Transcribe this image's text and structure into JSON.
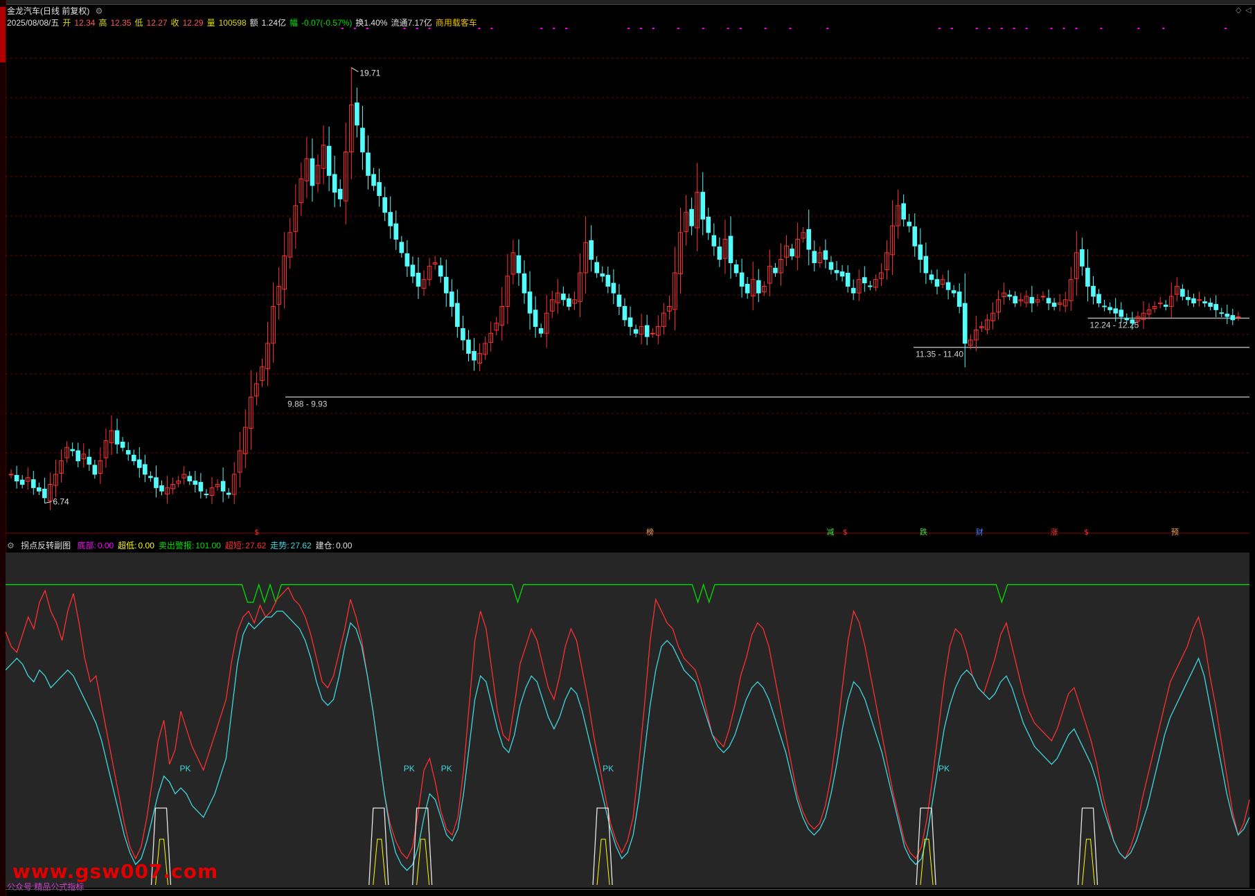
{
  "header": {
    "title": "金龙汽车(日线 前复权)",
    "date": "2025/08/08/五",
    "open_label": "开",
    "open": "12.34",
    "high_label": "高",
    "high": "12.35",
    "low_label": "低",
    "low": "12.27",
    "close_label": "收",
    "close": "12.29",
    "vol_label": "量",
    "vol": "100598",
    "amount_label": "额",
    "amount": "1.24亿",
    "change_label": "幅",
    "change": "-0.07(-0.57%)",
    "turnover": "换1.40%",
    "float": "流通7.17亿",
    "concept": "商用载客车"
  },
  "sub_header": {
    "name": "拐点反转副图",
    "items": [
      {
        "label": "底部:",
        "value": "0.00",
        "color": "#ff00ff"
      },
      {
        "label": "超低:",
        "value": "0.00",
        "color": "#ffff00"
      },
      {
        "label": "卖出警报:",
        "value": "101.00",
        "color": "#00e000"
      },
      {
        "label": "超短:",
        "value": "27.62",
        "color": "#ff3030"
      },
      {
        "label": "走势:",
        "value": "27.62",
        "color": "#40d8e0"
      },
      {
        "label": "建仓:",
        "value": "0.00",
        "color": "#e0e0e0"
      }
    ]
  },
  "watermark": "www.gsw007.com",
  "watermark_small": "公众号:精品公式指标",
  "colors": {
    "up": "#ff3232",
    "down": "#54fcfc",
    "grid": "#7a0000",
    "support": "#b0b0b0"
  },
  "chart_data": [
    {
      "type": "candlestick",
      "title": "金龙汽车(日线 前复权)",
      "ylim": [
        6.3,
        20.9
      ],
      "annotations": [
        {
          "text": "19.71",
          "value": 19.71,
          "kind": "high"
        },
        {
          "text": "6.74",
          "value": 6.74,
          "kind": "low"
        }
      ],
      "support_levels": [
        {
          "label": "9.88 - 9.93",
          "value": 9.9
        },
        {
          "label": "11.35 - 11.40",
          "value": 11.38
        },
        {
          "label": "12.24 - 12.25",
          "value": 12.25
        }
      ],
      "event_markers": [
        "$",
        "榜",
        "减",
        "$",
        "跌",
        "财",
        "涨",
        "$",
        "预"
      ],
      "closes": [
        7.6,
        7.4,
        7.3,
        7.5,
        7.2,
        7.1,
        6.9,
        7.3,
        7.6,
        8.0,
        8.4,
        8.3,
        8.0,
        8.2,
        7.9,
        7.6,
        8.0,
        8.6,
        8.9,
        8.5,
        8.4,
        8.2,
        8.0,
        7.8,
        7.6,
        7.5,
        7.2,
        7.1,
        7.2,
        7.3,
        7.4,
        7.6,
        7.4,
        7.3,
        7.1,
        7.0,
        7.2,
        7.3,
        7.1,
        7.0,
        7.6,
        8.3,
        9.0,
        9.9,
        10.3,
        10.8,
        11.5,
        12.6,
        13.2,
        14.1,
        14.8,
        15.6,
        16.4,
        17.0,
        16.2,
        16.8,
        17.4,
        16.5,
        16.0,
        15.8,
        17.2,
        18.6,
        18.0,
        17.2,
        16.5,
        16.2,
        15.9,
        15.4,
        15.0,
        14.6,
        14.2,
        13.8,
        13.5,
        13.2,
        13.4,
        13.8,
        13.9,
        13.5,
        13.0,
        12.6,
        12.0,
        11.6,
        11.2,
        11.0,
        11.2,
        11.5,
        11.8,
        12.1,
        12.6,
        13.5,
        14.2,
        13.6,
        13.0,
        12.4,
        12.0,
        11.8,
        12.4,
        12.8,
        13.0,
        12.8,
        12.6,
        12.8,
        13.6,
        14.5,
        14.0,
        13.6,
        13.5,
        13.2,
        13.0,
        12.6,
        12.2,
        12.0,
        11.8,
        12.0,
        11.7,
        11.8,
        12.0,
        12.4,
        12.6,
        13.6,
        14.8,
        15.4,
        15.0,
        16.0,
        15.2,
        14.8,
        14.4,
        14.0,
        14.6,
        13.9,
        13.6,
        13.2,
        13.0,
        13.4,
        13.0,
        13.2,
        13.8,
        13.6,
        14.0,
        14.4,
        14.1,
        14.6,
        14.8,
        14.3,
        13.9,
        14.2,
        14.0,
        13.7,
        13.6,
        13.5,
        13.2,
        13.0,
        13.4,
        13.3,
        13.2,
        13.4,
        13.6,
        14.2,
        15.0,
        15.6,
        15.2,
        15.0,
        14.4,
        14.0,
        13.6,
        13.4,
        13.2,
        13.4,
        13.1,
        13.0,
        12.6,
        11.5,
        11.6,
        11.9,
        12.0,
        12.2,
        12.4,
        12.8,
        13.0,
        12.9,
        12.7,
        12.8,
        12.9,
        12.7,
        12.8,
        12.9,
        12.7,
        12.6,
        12.7,
        12.8,
        13.4,
        14.2,
        13.8,
        13.2,
        12.9,
        12.7,
        12.6,
        12.5,
        12.4,
        12.3,
        12.2,
        12.1,
        12.3,
        12.4,
        12.5,
        12.6,
        12.7,
        12.6,
        12.9,
        13.2,
        12.9,
        12.8,
        12.7,
        12.8,
        12.7,
        12.6,
        12.5,
        12.4,
        12.3,
        12.2,
        12.29
      ]
    },
    {
      "type": "line",
      "title": "拐点反转副图",
      "ylim": [
        0,
        110
      ],
      "series": [
        {
          "name": "卖出警报",
          "color": "#00e000",
          "values": [
            101,
            101,
            101,
            101,
            101,
            101,
            101,
            101,
            101,
            101,
            101,
            101,
            101,
            101,
            101,
            101,
            101,
            101,
            101,
            101,
            101,
            101,
            101,
            101,
            101,
            101,
            101,
            101,
            101,
            101,
            101,
            101,
            101,
            101,
            101,
            101,
            101,
            101,
            101,
            101,
            101,
            101,
            101,
            95,
            95,
            101,
            95,
            101,
            95,
            101,
            101,
            101,
            101,
            101,
            101,
            101,
            101,
            101,
            101,
            101,
            101,
            101,
            101,
            101,
            101,
            101,
            101,
            101,
            101,
            101,
            101,
            101,
            101,
            101,
            101,
            101,
            101,
            101,
            101,
            101,
            101,
            101,
            101,
            101,
            101,
            101,
            101,
            101,
            101,
            101,
            101,
            95,
            101,
            101,
            101,
            101,
            101,
            101,
            101,
            101,
            101,
            101,
            101,
            101,
            101,
            101,
            101,
            101,
            101,
            101,
            101,
            101,
            101,
            101,
            101,
            101,
            101,
            101,
            101,
            101,
            101,
            101,
            101,
            95,
            101,
            95,
            101,
            101,
            101,
            101,
            101,
            101,
            101,
            101,
            101,
            101,
            101,
            101,
            101,
            101,
            101,
            101,
            101,
            101,
            101,
            101,
            101,
            101,
            101,
            101,
            101,
            101,
            101,
            101,
            101,
            101,
            101,
            101,
            101,
            101,
            101,
            101,
            101,
            101,
            101,
            101,
            101,
            101,
            101,
            101,
            101,
            101,
            101,
            101,
            101,
            101,
            101,
            95,
            101,
            101,
            101,
            101,
            101,
            101,
            101,
            101,
            101,
            101,
            101,
            101,
            101,
            101,
            101,
            101,
            101,
            101,
            101,
            101,
            101,
            101,
            101,
            101,
            101,
            101,
            101,
            101,
            101,
            101,
            101,
            101,
            101,
            101,
            101,
            101,
            101,
            101,
            101,
            101,
            101,
            101,
            101,
            101
          ]
        },
        {
          "name": "超短",
          "color": "#ff3030",
          "values": [
            85,
            80,
            78,
            84,
            90,
            86,
            95,
            99,
            92,
            88,
            82,
            92,
            98,
            88,
            76,
            68,
            70,
            60,
            50,
            40,
            30,
            20,
            12,
            8,
            12,
            22,
            35,
            48,
            55,
            40,
            45,
            58,
            52,
            46,
            42,
            38,
            44,
            50,
            56,
            62,
            75,
            85,
            90,
            92,
            88,
            94,
            90,
            92,
            96,
            98,
            100,
            96,
            94,
            90,
            84,
            76,
            68,
            66,
            70,
            78,
            86,
            96,
            90,
            82,
            70,
            58,
            44,
            30,
            20,
            14,
            10,
            8,
            12,
            24,
            38,
            42,
            34,
            24,
            18,
            16,
            22,
            38,
            60,
            82,
            92,
            86,
            72,
            58,
            50,
            48,
            60,
            74,
            80,
            86,
            82,
            74,
            66,
            62,
            70,
            80,
            86,
            82,
            72,
            62,
            50,
            40,
            30,
            20,
            14,
            10,
            14,
            22,
            40,
            60,
            82,
            96,
            92,
            88,
            86,
            80,
            76,
            74,
            72,
            66,
            58,
            50,
            48,
            46,
            52,
            60,
            70,
            76,
            84,
            88,
            86,
            80,
            70,
            60,
            50,
            40,
            30,
            24,
            20,
            18,
            20,
            26,
            36,
            50,
            66,
            82,
            92,
            88,
            80,
            70,
            60,
            50,
            40,
            30,
            22,
            14,
            10,
            8,
            12,
            22,
            36,
            52,
            68,
            80,
            86,
            84,
            78,
            70,
            66,
            64,
            70,
            76,
            84,
            88,
            80,
            72,
            64,
            58,
            54,
            52,
            50,
            48,
            52,
            58,
            64,
            66,
            60,
            54,
            48,
            40,
            30,
            22,
            14,
            10,
            8,
            12,
            18,
            28,
            36,
            44,
            52,
            60,
            68,
            72,
            76,
            80,
            86,
            90,
            82,
            70,
            60,
            48,
            36,
            24,
            16,
            20,
            28
          ]
        },
        {
          "name": "走势",
          "color": "#40d8e0",
          "values": [
            72,
            74,
            76,
            74,
            70,
            68,
            72,
            70,
            66,
            68,
            70,
            72,
            70,
            66,
            62,
            58,
            54,
            48,
            40,
            32,
            24,
            16,
            10,
            6,
            8,
            14,
            22,
            30,
            36,
            34,
            30,
            32,
            30,
            26,
            24,
            22,
            26,
            30,
            36,
            42,
            58,
            74,
            84,
            88,
            86,
            88,
            90,
            90,
            92,
            92,
            90,
            88,
            86,
            82,
            76,
            68,
            62,
            60,
            62,
            70,
            80,
            88,
            86,
            80,
            70,
            58,
            44,
            30,
            18,
            10,
            6,
            4,
            6,
            12,
            22,
            30,
            28,
            22,
            16,
            14,
            18,
            30,
            46,
            62,
            70,
            68,
            60,
            52,
            46,
            44,
            50,
            60,
            66,
            70,
            68,
            62,
            56,
            52,
            56,
            62,
            66,
            64,
            58,
            50,
            42,
            34,
            26,
            18,
            12,
            8,
            10,
            16,
            28,
            44,
            60,
            72,
            80,
            82,
            80,
            76,
            72,
            70,
            68,
            62,
            56,
            50,
            46,
            44,
            46,
            50,
            56,
            62,
            66,
            68,
            66,
            62,
            56,
            50,
            44,
            36,
            28,
            22,
            18,
            16,
            18,
            22,
            30,
            40,
            52,
            62,
            68,
            66,
            62,
            56,
            50,
            44,
            36,
            28,
            20,
            12,
            8,
            6,
            8,
            16,
            28,
            40,
            52,
            60,
            66,
            70,
            72,
            70,
            66,
            64,
            62,
            64,
            68,
            70,
            66,
            60,
            54,
            50,
            46,
            44,
            42,
            40,
            42,
            46,
            50,
            52,
            48,
            44,
            40,
            34,
            26,
            20,
            14,
            10,
            8,
            10,
            14,
            20,
            26,
            34,
            42,
            50,
            56,
            60,
            64,
            68,
            72,
            76,
            70,
            60,
            50,
            40,
            30,
            22,
            16,
            18,
            22
          ]
        }
      ]
    }
  ]
}
